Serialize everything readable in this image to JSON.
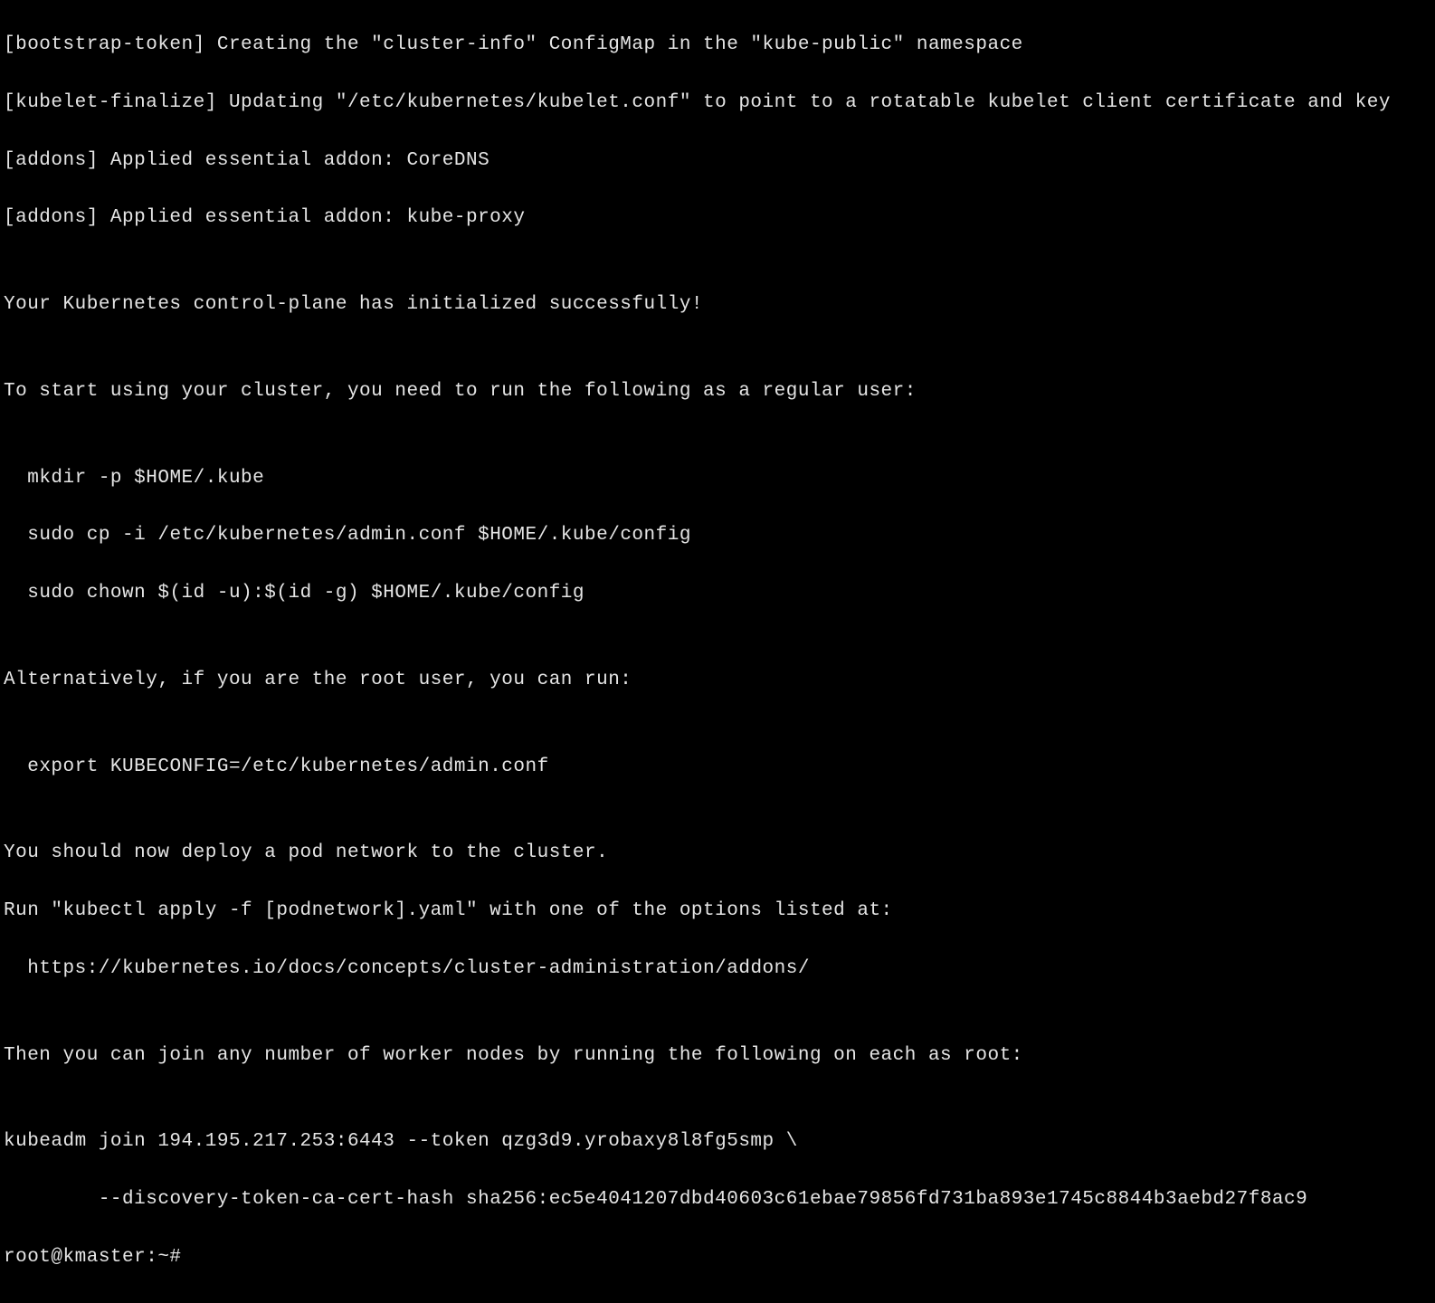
{
  "terminal": {
    "lines": [
      "[bootstrap-token] Creating the \"cluster-info\" ConfigMap in the \"kube-public\" namespace",
      "[kubelet-finalize] Updating \"/etc/kubernetes/kubelet.conf\" to point to a rotatable kubelet client certificate and key",
      "[addons] Applied essential addon: CoreDNS",
      "[addons] Applied essential addon: kube-proxy",
      "",
      "Your Kubernetes control-plane has initialized successfully!",
      "",
      "To start using your cluster, you need to run the following as a regular user:",
      "",
      "  mkdir -p $HOME/.kube",
      "  sudo cp -i /etc/kubernetes/admin.conf $HOME/.kube/config",
      "  sudo chown $(id -u):$(id -g) $HOME/.kube/config",
      "",
      "Alternatively, if you are the root user, you can run:",
      "",
      "  export KUBECONFIG=/etc/kubernetes/admin.conf",
      "",
      "You should now deploy a pod network to the cluster.",
      "Run \"kubectl apply -f [podnetwork].yaml\" with one of the options listed at:",
      "  https://kubernetes.io/docs/concepts/cluster-administration/addons/",
      "",
      "Then you can join any number of worker nodes by running the following on each as root:",
      "",
      "kubeadm join 194.195.217.253:6443 --token qzg3d9.yrobaxy8l8fg5smp \\",
      "        --discovery-token-ca-cert-hash sha256:ec5e4041207dbd40603c61ebae79856fd731ba893e1745c8844b3aebd27f8ac9"
    ],
    "prompt": "root@kmaster:~# "
  }
}
